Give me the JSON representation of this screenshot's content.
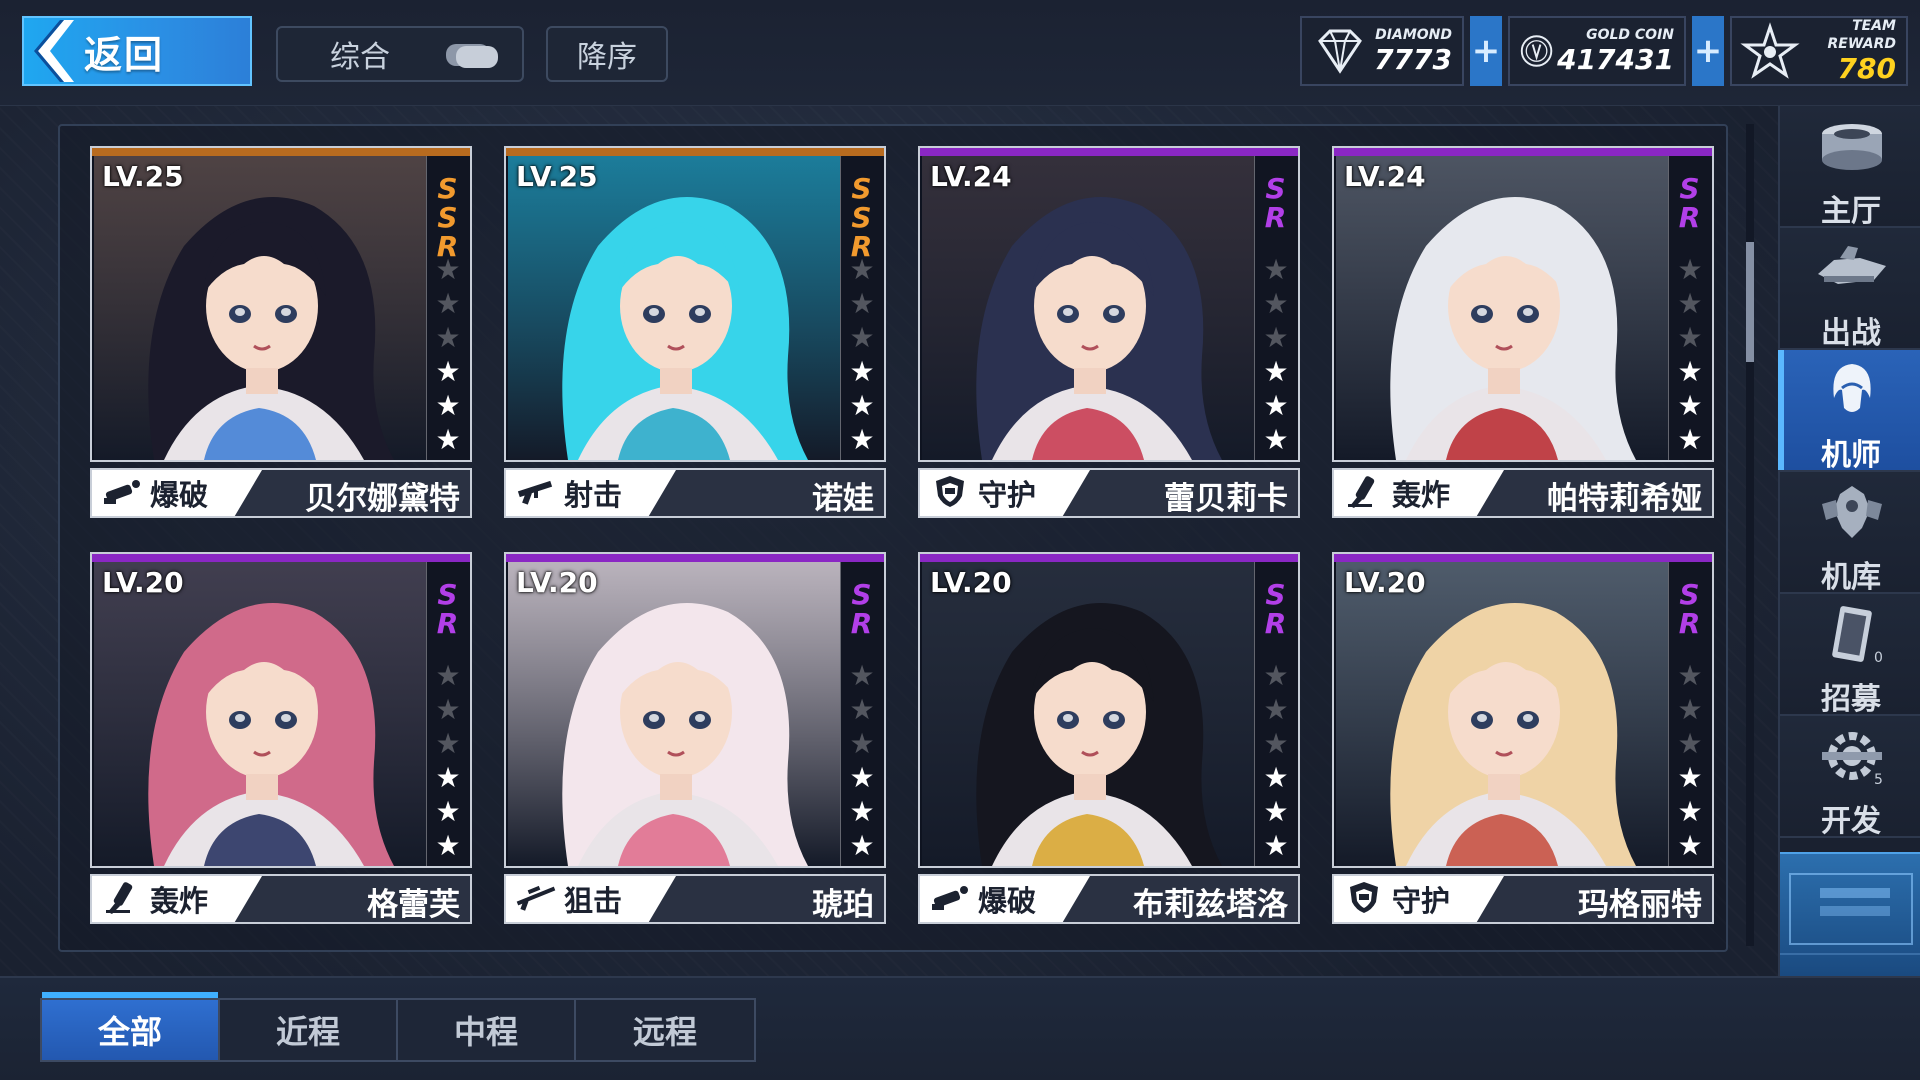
{
  "header": {
    "back_label": "返回",
    "sort_label": "综合",
    "order_label": "降序"
  },
  "currencies": [
    {
      "label": "DIAMOND",
      "value": "7773",
      "icon": "diamond-icon"
    },
    {
      "label": "GOLD COIN",
      "value": "417431",
      "icon": "gold-coin-icon"
    },
    {
      "label": "TEAM REWARD",
      "value": "780",
      "icon": "team-reward-star-icon"
    }
  ],
  "pilots": [
    {
      "level": "LV.25",
      "rarity": "SSR",
      "stars": 3,
      "class": "爆破",
      "class_icon": "demolition-icon",
      "name": "贝尔娜黛特",
      "hair": "#1b1a2a",
      "accent": "#3a7bd5",
      "bg": "#5a4b4a"
    },
    {
      "level": "LV.25",
      "rarity": "SSR",
      "stars": 3,
      "class": "射击",
      "class_icon": "rifle-icon",
      "name": "诺娃",
      "hair": "#37d4ea",
      "accent": "#20a9c9",
      "bg": "#1e8fb0"
    },
    {
      "level": "LV.24",
      "rarity": "SR",
      "stars": 3,
      "class": "守护",
      "class_icon": "shield-icon",
      "name": "蕾贝莉卡",
      "hair": "#2b3150",
      "accent": "#c7344a",
      "bg": "#3b3540"
    },
    {
      "level": "LV.24",
      "rarity": "SR",
      "stars": 3,
      "class": "轰炸",
      "class_icon": "bomber-icon",
      "name": "帕特莉希娅",
      "hair": "#e6e8ee",
      "accent": "#b8262c",
      "bg": "#58606e"
    },
    {
      "level": "LV.20",
      "rarity": "SR",
      "stars": 3,
      "class": "轰炸",
      "class_icon": "bomber-icon",
      "name": "格蕾芙",
      "hair": "#d06a8a",
      "accent": "#1f2a5a",
      "bg": "#4a4658"
    },
    {
      "level": "LV.20",
      "rarity": "SR",
      "stars": 3,
      "class": "狙击",
      "class_icon": "sniper-icon",
      "name": "琥珀",
      "hair": "#f3e6ec",
      "accent": "#e06a8a",
      "bg": "#d8cfd8"
    },
    {
      "level": "LV.20",
      "rarity": "SR",
      "stars": 3,
      "class": "爆破",
      "class_icon": "demolition-icon",
      "name": "布莉兹塔洛",
      "hair": "#15161f",
      "accent": "#d8a528",
      "bg": "#2a3242"
    },
    {
      "level": "LV.20",
      "rarity": "SR",
      "stars": 3,
      "class": "守护",
      "class_icon": "shield-icon",
      "name": "玛格丽特",
      "hair": "#efd3a6",
      "accent": "#c64a3a",
      "bg": "#5a6878"
    }
  ],
  "nav": [
    {
      "label": "主厅",
      "icon": "main-hall-icon",
      "active": false
    },
    {
      "label": "出战",
      "icon": "sortie-ship-icon",
      "active": false
    },
    {
      "label": "机师",
      "icon": "pilot-icon",
      "active": true
    },
    {
      "label": "机库",
      "icon": "hangar-mech-icon",
      "active": false
    },
    {
      "label": "招募",
      "icon": "recruit-card-icon",
      "active": false,
      "badge": "0"
    },
    {
      "label": "开发",
      "icon": "develop-gear-icon",
      "active": false,
      "badge": "5"
    }
  ],
  "tabs": [
    {
      "label": "全部",
      "active": true
    },
    {
      "label": "近程",
      "active": false
    },
    {
      "label": "中程",
      "active": false
    },
    {
      "label": "远程",
      "active": false
    }
  ],
  "colors": {
    "accent": "#2b8fe4",
    "ssr": "#f29a2e",
    "sr": "#b23fe8",
    "team_reward": "#ffd21f"
  }
}
